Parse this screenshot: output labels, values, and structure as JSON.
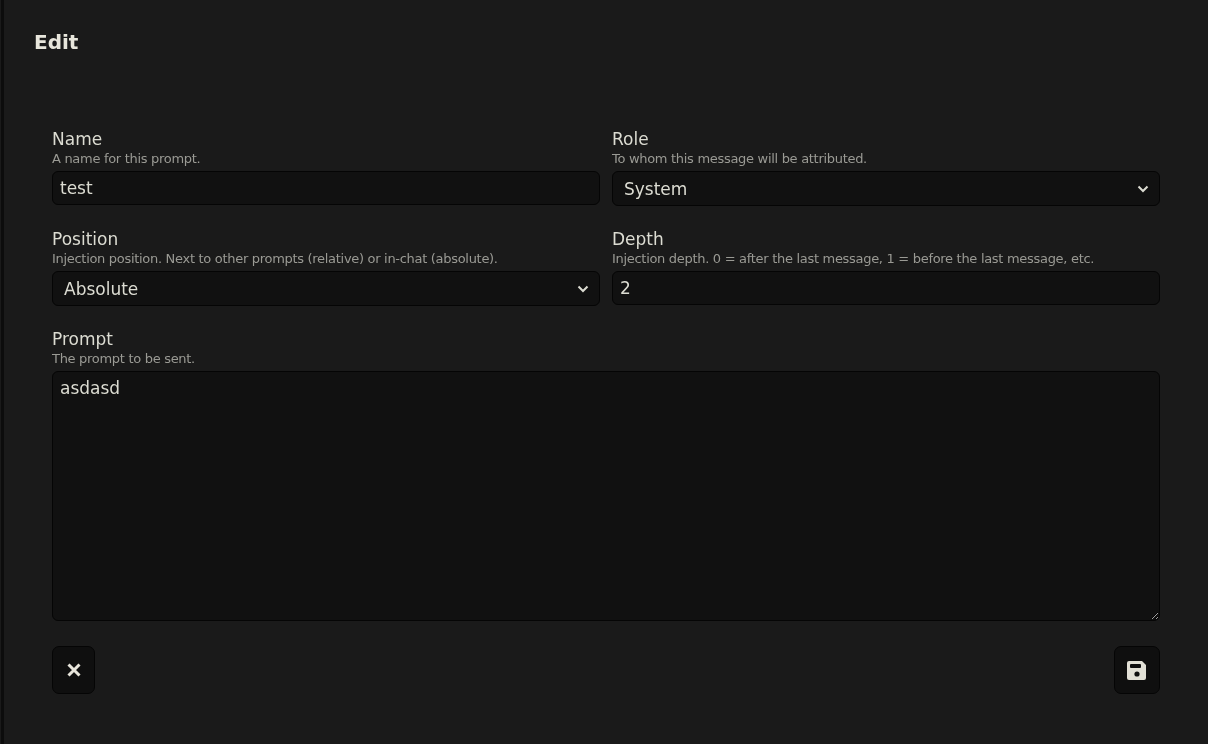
{
  "title": "Edit",
  "fields": [
    {
      "kind": "text",
      "label": "Name",
      "hint": "A name for this prompt.",
      "value": "test"
    },
    {
      "kind": "select",
      "label": "Role",
      "hint": "To whom this message will be attributed.",
      "value": "System"
    },
    {
      "kind": "select",
      "label": "Position",
      "hint": "Injection position. Next to other prompts (relative) or in-chat (absolute).",
      "value": "Absolute"
    },
    {
      "kind": "text",
      "label": "Depth",
      "hint": "Injection depth. 0 = after the last message, 1 = before the last message, etc.",
      "value": "2"
    },
    {
      "kind": "textarea",
      "label": "Prompt",
      "hint": "The prompt to be sent.",
      "value": "asdasd"
    }
  ]
}
